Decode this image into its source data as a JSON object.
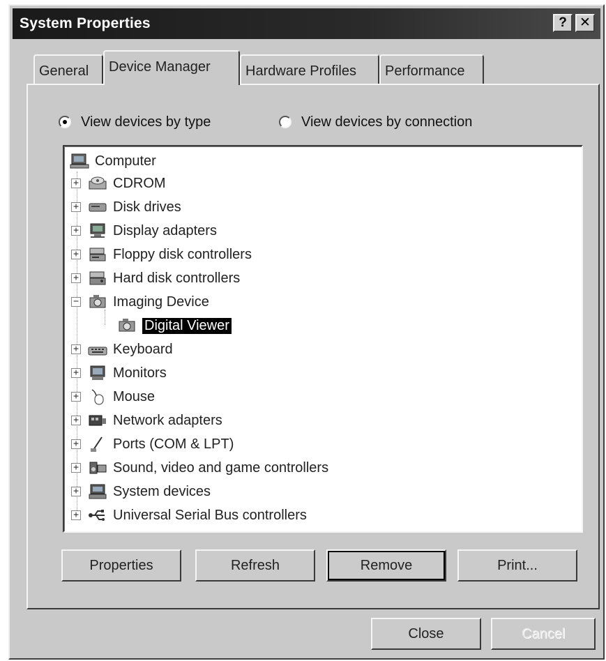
{
  "window": {
    "title": "System Properties",
    "help_label": "?",
    "close_glyph": "✕"
  },
  "tabs": [
    {
      "label": "General",
      "active": false
    },
    {
      "label": "Device Manager",
      "active": true
    },
    {
      "label": "Hardware Profiles",
      "active": false
    },
    {
      "label": "Performance",
      "active": false
    }
  ],
  "view_options": {
    "by_type": {
      "label": "View devices by type",
      "checked": true
    },
    "by_connection": {
      "label": "View devices by connection",
      "checked": false
    }
  },
  "tree": {
    "root": {
      "label": "Computer",
      "icon": "computer-icon"
    },
    "items": [
      {
        "label": "CDROM",
        "icon": "cdrom-icon",
        "expander": "+"
      },
      {
        "label": "Disk drives",
        "icon": "disk-drive-icon",
        "expander": "+"
      },
      {
        "label": "Display adapters",
        "icon": "display-adapter-icon",
        "expander": "+"
      },
      {
        "label": "Floppy disk controllers",
        "icon": "floppy-controller-icon",
        "expander": "+"
      },
      {
        "label": "Hard disk controllers",
        "icon": "hard-disk-controller-icon",
        "expander": "+"
      },
      {
        "label": "Imaging Device",
        "icon": "imaging-device-icon",
        "expander": "−"
      },
      {
        "label": "Digital Viewer",
        "icon": "digital-viewer-icon",
        "selected": true
      },
      {
        "label": "Keyboard",
        "icon": "keyboard-icon",
        "expander": "+"
      },
      {
        "label": "Monitors",
        "icon": "monitor-icon",
        "expander": "+"
      },
      {
        "label": "Mouse",
        "icon": "mouse-icon",
        "expander": "+"
      },
      {
        "label": "Network adapters",
        "icon": "network-adapter-icon",
        "expander": "+"
      },
      {
        "label": "Ports (COM & LPT)",
        "icon": "ports-icon",
        "expander": "+"
      },
      {
        "label": "Sound, video and game controllers",
        "icon": "sound-icon",
        "expander": "+"
      },
      {
        "label": "System devices",
        "icon": "system-devices-icon",
        "expander": "+"
      },
      {
        "label": "Universal Serial Bus controllers",
        "icon": "usb-icon",
        "expander": "+"
      }
    ]
  },
  "buttons": {
    "properties": "Properties",
    "refresh": "Refresh",
    "remove": "Remove",
    "print": "Print..."
  },
  "footer": {
    "close": "Close",
    "cancel": "Cancel"
  },
  "colors": {
    "dialog_bg": "#c9c9c9",
    "title_bar": "#1a1a1a",
    "selection": "#000000"
  }
}
